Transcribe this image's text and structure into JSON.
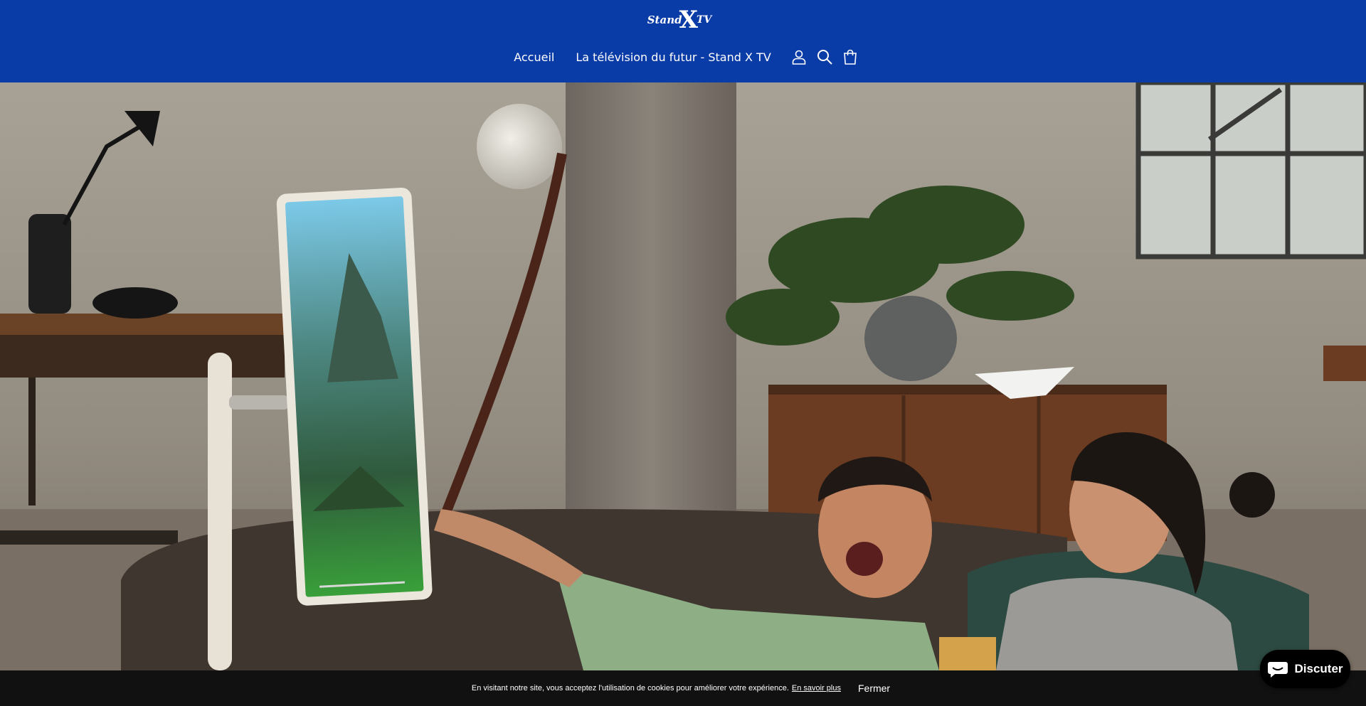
{
  "header": {
    "logo_text_1": "Stand",
    "logo_text_x": "X",
    "logo_text_2": "TV",
    "nav": [
      "Accueil",
      "La télévision du futur - Stand X TV"
    ],
    "icons": [
      "account-icon",
      "search-icon",
      "cart-icon"
    ],
    "bg_color": "#0a3ca8"
  },
  "cookie_bar": {
    "message": "En visitant notre site, vous acceptez l'utilisation de cookies pour améliorer votre expérience.",
    "learn_more": "En savoir plus",
    "close": "Fermer"
  },
  "chat": {
    "label": "Discuter",
    "icon": "chat-bubble-icon"
  }
}
